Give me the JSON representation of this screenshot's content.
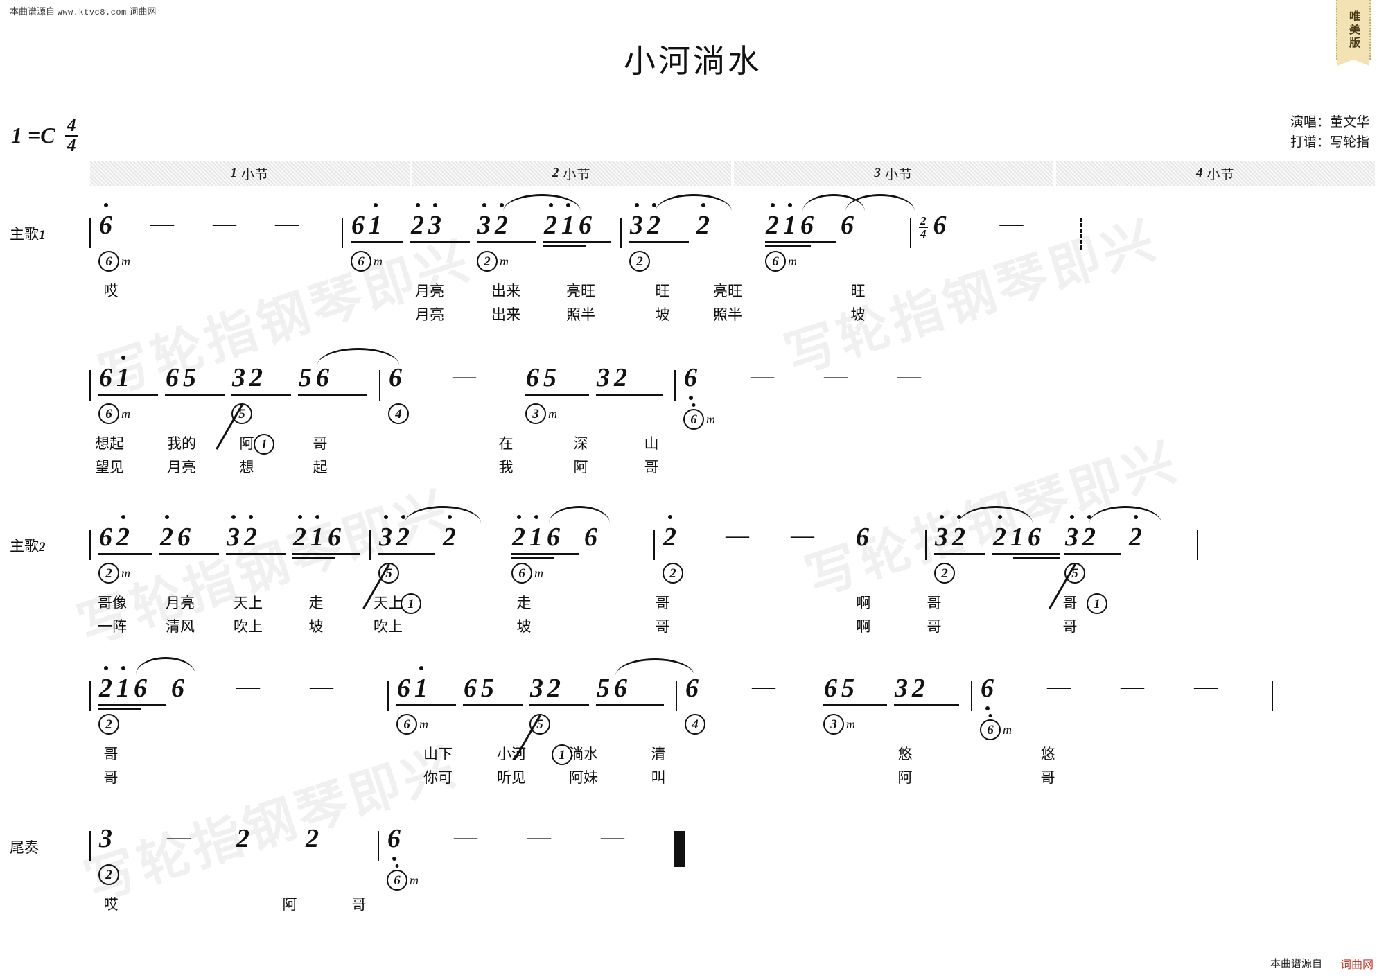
{
  "source_line": {
    "prefix": "本曲谱源自",
    "url": "www.ktvc8.com",
    "site": "词曲网"
  },
  "badge": {
    "label": "唯美版"
  },
  "header": {
    "title": "小河淌水",
    "key_label": "1 =C",
    "meter": {
      "num": "4",
      "den": "4"
    },
    "credits": [
      "演唱：董文华",
      "打谱：写轮指"
    ]
  },
  "measure_bar": [
    {
      "num": "1",
      "label": "小节"
    },
    {
      "num": "2",
      "label": "小节"
    },
    {
      "num": "3",
      "label": "小节"
    },
    {
      "num": "4",
      "label": "小节"
    }
  ],
  "watermarks": [
    "写轮指钢琴即兴",
    "写轮指钢琴即兴",
    "写轮指钢琴即兴",
    "写轮指钢琴即兴",
    "写轮指钢琴即兴"
  ],
  "rows": [
    {
      "label": "主歌",
      "label_num": "1",
      "notes": "6 - - - | 61 23 32 216 | 32 2 216 6 | (2/4) 6 - :",
      "chords": [
        "6m",
        "6m",
        "2m",
        "2",
        "6m"
      ],
      "lyrics_line1": [
        "哎",
        "月亮",
        "出来",
        "亮旺",
        "旺",
        "亮旺",
        "旺"
      ],
      "lyrics_line2": [
        "",
        "月亮",
        "出来",
        "照半",
        "坡",
        "照半",
        "坡"
      ]
    },
    {
      "label": "",
      "label_num": "",
      "notes": "61 65 32 56 | 6 - 65 32 | 6 - - -",
      "chords": [
        "6m",
        "5/1",
        "4",
        "3m",
        "6m"
      ],
      "lyrics_line1": [
        "想起",
        "我的",
        "阿",
        "哥",
        "",
        "在",
        "深",
        "山"
      ],
      "lyrics_line2": [
        "望见",
        "月亮",
        "想",
        "起",
        "",
        "我",
        "阿",
        "哥"
      ]
    },
    {
      "label": "主歌",
      "label_num": "2",
      "notes": "62 26 32 216 | 32 2 216 6 | 2 - - 6 | 32 216 32 2 |",
      "chords": [
        "2m",
        "5/1",
        "6m",
        "2",
        "2",
        "5/1"
      ],
      "lyrics_line1": [
        "哥像",
        "月亮",
        "天上",
        "走",
        "天上",
        "走",
        "哥",
        "啊",
        "哥",
        "哥"
      ],
      "lyrics_line2": [
        "一阵",
        "清风",
        "吹上",
        "坡",
        "吹上",
        "坡",
        "哥",
        "啊",
        "哥",
        "哥"
      ]
    },
    {
      "label": "",
      "label_num": "",
      "notes": "216 6 - - | 61 65 32 56 | 6 - 65 32 | 6 - - -",
      "chords": [
        "2",
        "6m",
        "5/1",
        "4",
        "3m",
        "6m"
      ],
      "lyrics_line1": [
        "哥",
        "山下",
        "小河",
        "淌水",
        "清",
        "悠",
        "悠"
      ],
      "lyrics_line2": [
        "哥",
        "你可",
        "听见",
        "阿妹",
        "叫",
        "阿",
        "哥"
      ]
    },
    {
      "label": "尾奏",
      "label_num": "",
      "notes": "3 - 2 2 | 6 - - - ||",
      "chords": [
        "2",
        "6m"
      ],
      "lyrics_line1": [
        "哎",
        "阿",
        "哥"
      ],
      "lyrics_line2": []
    }
  ],
  "footer": {
    "prefix": "本曲谱源自",
    "site": "词曲网"
  }
}
